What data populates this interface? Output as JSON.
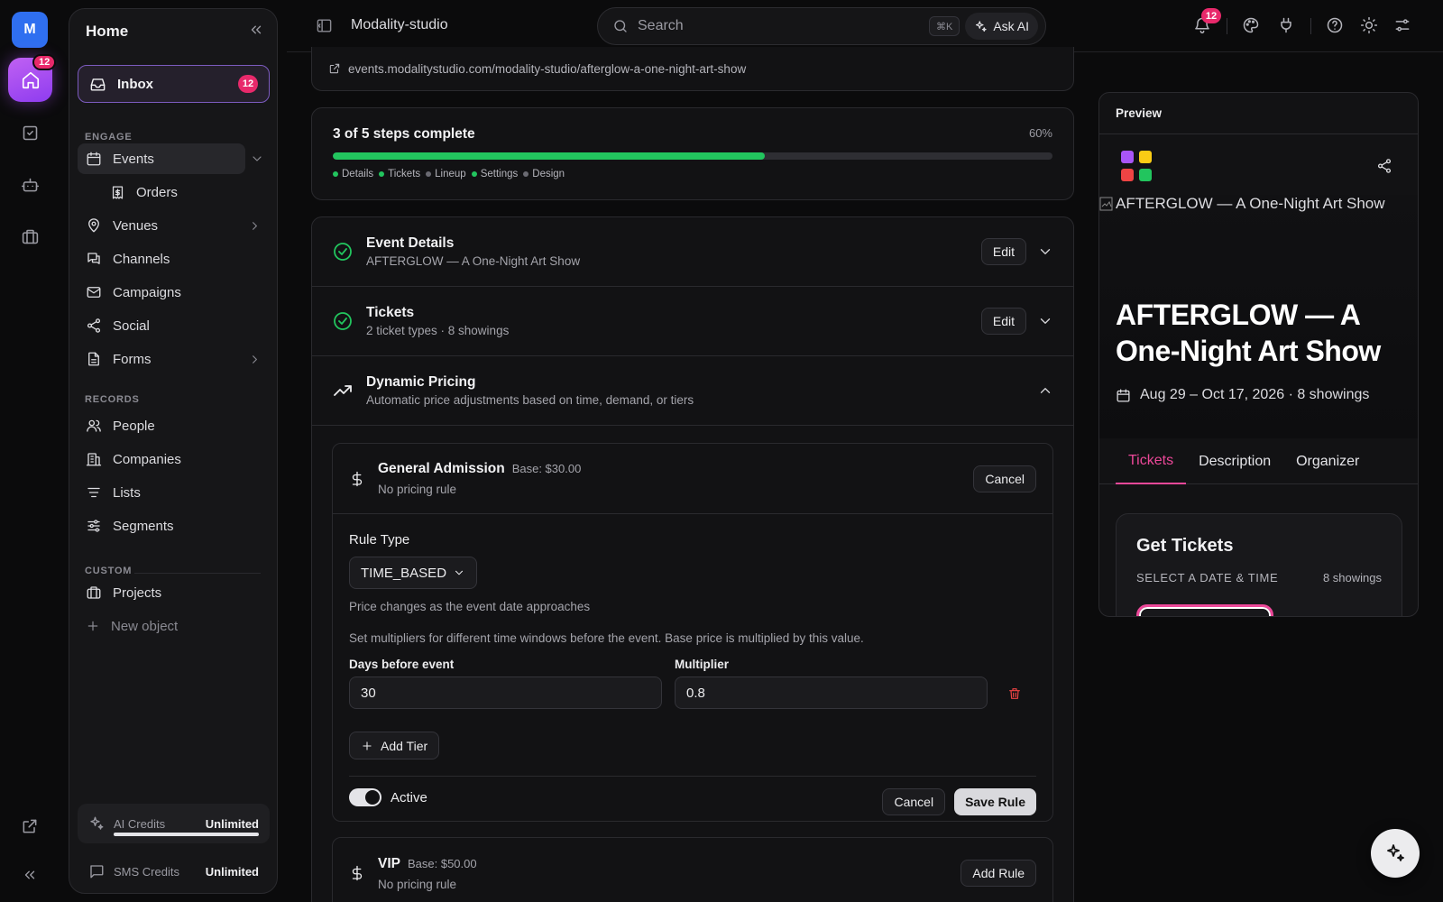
{
  "rail": {
    "avatar_initial": "M",
    "home_badge": "12"
  },
  "sidebar": {
    "title": "Home",
    "inbox": {
      "label": "Inbox",
      "badge": "12"
    },
    "engage_label": "ENGAGE",
    "engage_items": [
      {
        "label": "Events"
      },
      {
        "label": "Orders"
      },
      {
        "label": "Venues"
      },
      {
        "label": "Channels"
      },
      {
        "label": "Campaigns"
      },
      {
        "label": "Social"
      },
      {
        "label": "Forms"
      }
    ],
    "records_label": "RECORDS",
    "records_items": [
      {
        "label": "People"
      },
      {
        "label": "Companies"
      },
      {
        "label": "Lists"
      },
      {
        "label": "Segments"
      }
    ],
    "custom_label": "CUSTOM",
    "custom_items": [
      {
        "label": "Projects"
      },
      {
        "label": "New object"
      }
    ],
    "credits": [
      {
        "label": "AI Credits",
        "value": "Unlimited"
      },
      {
        "label": "SMS Credits",
        "value": "Unlimited"
      }
    ]
  },
  "topbar": {
    "title": "Modality-studio",
    "search_placeholder": "Search",
    "shortcut": "⌘K",
    "ask_ai": "Ask AI",
    "notification_badge": "12"
  },
  "main": {
    "url": "events.modalitystudio.com/modality-studio/afterglow-a-one-night-art-show",
    "progress": {
      "title": "3 of 5 steps complete",
      "percent_label": "60%",
      "percent": 60,
      "steps": [
        {
          "label": "Details",
          "done": true
        },
        {
          "label": "Tickets",
          "done": true
        },
        {
          "label": "Lineup",
          "done": false
        },
        {
          "label": "Settings",
          "done": true
        },
        {
          "label": "Design",
          "done": false
        }
      ]
    },
    "sections": [
      {
        "title": "Event Details",
        "subtitle": "AFTERGLOW — A One-Night Art Show",
        "action": "Edit"
      },
      {
        "title": "Tickets",
        "subtitle": "2 ticket types · 8 showings",
        "action": "Edit"
      },
      {
        "title": "Dynamic Pricing",
        "subtitle": "Automatic price adjustments based on time, demand, or tiers"
      }
    ],
    "pricing": {
      "general": {
        "name": "General Admission",
        "base": "Base: $30.00",
        "rule": "No pricing rule",
        "cancel": "Cancel",
        "rule_type_label": "Rule Type",
        "rule_type_value": "TIME_BASED",
        "rule_type_help": "Price changes as the event date approaches",
        "multiplier_help": "Set multipliers for different time windows before the event. Base price is multiplied by this value.",
        "days_label": "Days before event",
        "days_value": "30",
        "multiplier_label": "Multiplier",
        "multiplier_value": "0.8",
        "add_tier": "Add Tier",
        "active_label": "Active",
        "active": true,
        "footer_cancel": "Cancel",
        "save": "Save Rule"
      },
      "vip": {
        "name": "VIP",
        "base": "Base: $50.00",
        "rule": "No pricing rule",
        "add_rule": "Add Rule"
      }
    }
  },
  "preview": {
    "header": "Preview",
    "image_alt": "AFTERGLOW — A One-Night Art Show",
    "title": "AFTERGLOW — A One-Night Art Show",
    "date": "Aug 29 – Oct 17, 2026 · 8 showings",
    "tabs": [
      "Tickets",
      "Description",
      "Organizer"
    ],
    "tickets_title": "Get Tickets",
    "select_label": "SELECT A DATE & TIME",
    "showings": "8 showings"
  },
  "colors": {
    "accent_pink": "#e8296b",
    "progress_green": "#22c55e",
    "logo": [
      "#a855f7",
      "#facc15",
      "#ef4444",
      "#22c55e"
    ]
  }
}
